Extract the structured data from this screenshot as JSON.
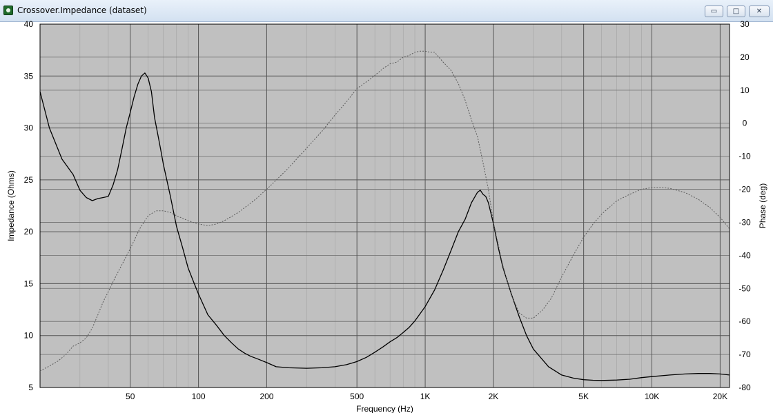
{
  "window": {
    "title": "Crossover.Impedance (dataset)",
    "buttons": {
      "minimize": "▭",
      "maximize": "□",
      "close": "✕"
    }
  },
  "chart_data": {
    "type": "line",
    "xlabel": "Frequency (Hz)",
    "ylabel": "Impedance (Ohms)",
    "y2label": "Phase (deg)",
    "xscale": "log",
    "xlim": [
      20,
      22000
    ],
    "ylim": [
      5,
      40
    ],
    "y2lim": [
      -80,
      30
    ],
    "x_ticks": [
      {
        "value": 50,
        "label": "50"
      },
      {
        "value": 100,
        "label": "100"
      },
      {
        "value": 200,
        "label": "200"
      },
      {
        "value": 500,
        "label": "500"
      },
      {
        "value": 1000,
        "label": "1K"
      },
      {
        "value": 2000,
        "label": "2K"
      },
      {
        "value": 5000,
        "label": "5K"
      },
      {
        "value": 10000,
        "label": "10K"
      },
      {
        "value": 20000,
        "label": "20K"
      }
    ],
    "y_ticks": [
      5,
      10,
      15,
      20,
      25,
      30,
      35,
      40
    ],
    "y2_ticks": [
      -80,
      -70,
      -60,
      -50,
      -40,
      -30,
      -20,
      -10,
      0,
      10,
      20,
      30
    ],
    "grid": true,
    "colors": {
      "plot_bg": "#c0c0c0",
      "impedance": "#000000",
      "phase": "#5a5a5a",
      "grid": "#555555"
    },
    "series": [
      {
        "axis": "left",
        "style": "solid",
        "x": [
          20,
          22,
          25,
          28,
          30,
          32,
          34,
          36,
          38,
          40,
          42,
          44,
          46,
          48,
          50,
          52,
          54,
          56,
          58,
          60,
          62,
          64,
          66,
          68,
          70,
          75,
          80,
          85,
          90,
          95,
          100,
          110,
          120,
          130,
          140,
          150,
          160,
          170,
          180,
          200,
          220,
          250,
          300,
          350,
          400,
          450,
          500,
          550,
          600,
          650,
          700,
          750,
          800,
          850,
          900,
          1000,
          1100,
          1200,
          1300,
          1400,
          1500,
          1600,
          1700,
          1750,
          1800,
          1850,
          1900,
          2000,
          2100,
          2200,
          2400,
          2600,
          2800,
          3000,
          3500,
          4000,
          4500,
          5000,
          5500,
          6000,
          7000,
          8000,
          9000,
          10000,
          12000,
          14000,
          16000,
          18000,
          20000,
          22000
        ],
        "y": [
          33.5,
          30.0,
          27.0,
          25.5,
          24.0,
          23.3,
          23.0,
          23.2,
          23.3,
          23.4,
          24.5,
          26.0,
          28.0,
          30.0,
          31.5,
          33.0,
          34.2,
          35.0,
          35.3,
          34.8,
          33.5,
          31.0,
          29.5,
          28.0,
          26.5,
          23.5,
          20.5,
          18.5,
          16.5,
          15.2,
          14.0,
          12.0,
          11.0,
          10.0,
          9.3,
          8.7,
          8.3,
          8.0,
          7.8,
          7.4,
          7.0,
          6.9,
          6.85,
          6.9,
          7.0,
          7.2,
          7.5,
          7.9,
          8.4,
          8.9,
          9.4,
          9.8,
          10.3,
          10.8,
          11.4,
          12.8,
          14.4,
          16.3,
          18.2,
          20.0,
          21.2,
          22.8,
          23.8,
          24.0,
          23.6,
          23.4,
          22.8,
          20.8,
          18.5,
          16.6,
          14.0,
          11.8,
          10.0,
          8.7,
          7.0,
          6.2,
          5.9,
          5.75,
          5.7,
          5.68,
          5.72,
          5.8,
          5.95,
          6.05,
          6.2,
          6.3,
          6.35,
          6.35,
          6.3,
          6.2
        ]
      },
      {
        "axis": "right",
        "style": "dashed",
        "x": [
          20,
          22,
          24,
          26,
          28,
          30,
          32,
          34,
          36,
          38,
          40,
          42,
          45,
          50,
          55,
          60,
          65,
          70,
          75,
          80,
          90,
          100,
          110,
          120,
          130,
          150,
          175,
          200,
          250,
          300,
          350,
          400,
          450,
          500,
          550,
          600,
          650,
          700,
          750,
          800,
          850,
          900,
          950,
          1000,
          1050,
          1100,
          1200,
          1300,
          1400,
          1500,
          1600,
          1700,
          1800,
          1900,
          2000,
          2200,
          2400,
          2600,
          2800,
          3000,
          3300,
          3600,
          4000,
          4500,
          5000,
          5500,
          6000,
          7000,
          8000,
          9000,
          10000,
          11000,
          12000,
          14000,
          16000,
          18000,
          20000,
          22000
        ],
        "y": [
          -75,
          -73.5,
          -72,
          -70,
          -67.5,
          -66.5,
          -65,
          -62,
          -58,
          -54,
          -51,
          -48,
          -44,
          -38,
          -32,
          -28,
          -26.5,
          -26.5,
          -27,
          -28,
          -29.5,
          -30.5,
          -31,
          -30.5,
          -29.5,
          -27,
          -23.5,
          -20,
          -13.5,
          -7.5,
          -2.5,
          2.5,
          6.5,
          10.5,
          12.5,
          14.5,
          16.5,
          18,
          18.5,
          20,
          20.5,
          21.5,
          21.8,
          21.8,
          21.5,
          21.5,
          18.5,
          16.0,
          12.0,
          7.0,
          1.0,
          -4.0,
          -12.0,
          -20.0,
          -30.0,
          -43.0,
          -52.0,
          -57.5,
          -59.0,
          -59.0,
          -56.5,
          -53.0,
          -46.5,
          -40.0,
          -34.5,
          -30.5,
          -27.5,
          -23.5,
          -21.5,
          -20.0,
          -19.5,
          -19.5,
          -19.7,
          -21.0,
          -23.0,
          -25.5,
          -28.5,
          -32.0
        ]
      }
    ]
  }
}
